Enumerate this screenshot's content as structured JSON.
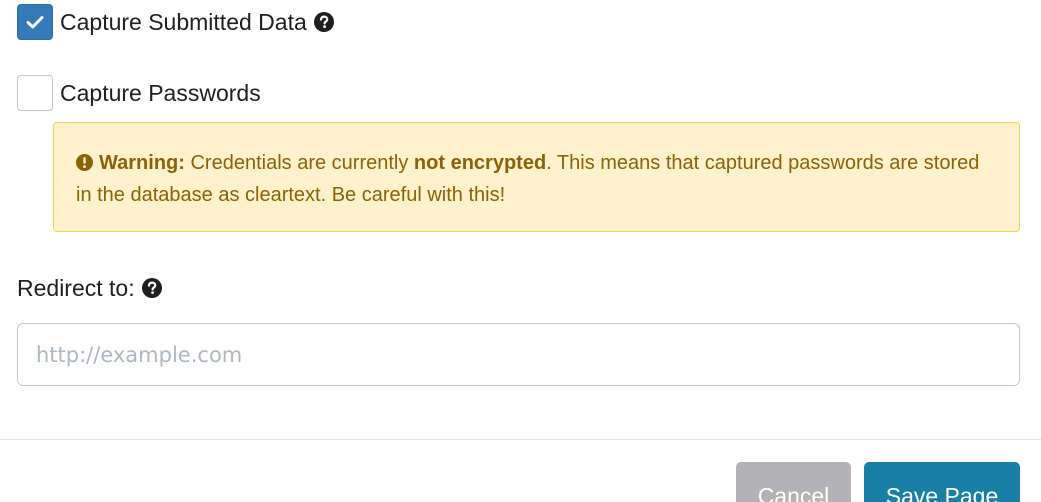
{
  "options": {
    "capture_submitted_data": {
      "label": "Capture Submitted Data",
      "checked": true
    },
    "capture_passwords": {
      "label": "Capture Passwords",
      "checked": false
    }
  },
  "warning": {
    "title": "Warning:",
    "text_before": "Credentials are currently",
    "emphasis": "not encrypted",
    "text_after": ". This means that captured passwords are stored in the database as cleartext. Be careful with this!"
  },
  "redirect": {
    "label": "Redirect to:",
    "value": "",
    "placeholder": "http://example.com"
  },
  "footer": {
    "cancel_label": "Cancel",
    "save_label": "Save Page"
  },
  "icons": {
    "checkbox_checked": "check-icon",
    "help": "question-circle-icon",
    "warning": "exclamation-circle-icon"
  },
  "colors": {
    "checkbox_checked": "#337ab7",
    "warning_bg": "#fff2cc",
    "warning_border": "#f3d25c",
    "warning_text": "#8a6209",
    "cancel_button": "#b3b3b5",
    "save_button": "#1a7fa4"
  }
}
